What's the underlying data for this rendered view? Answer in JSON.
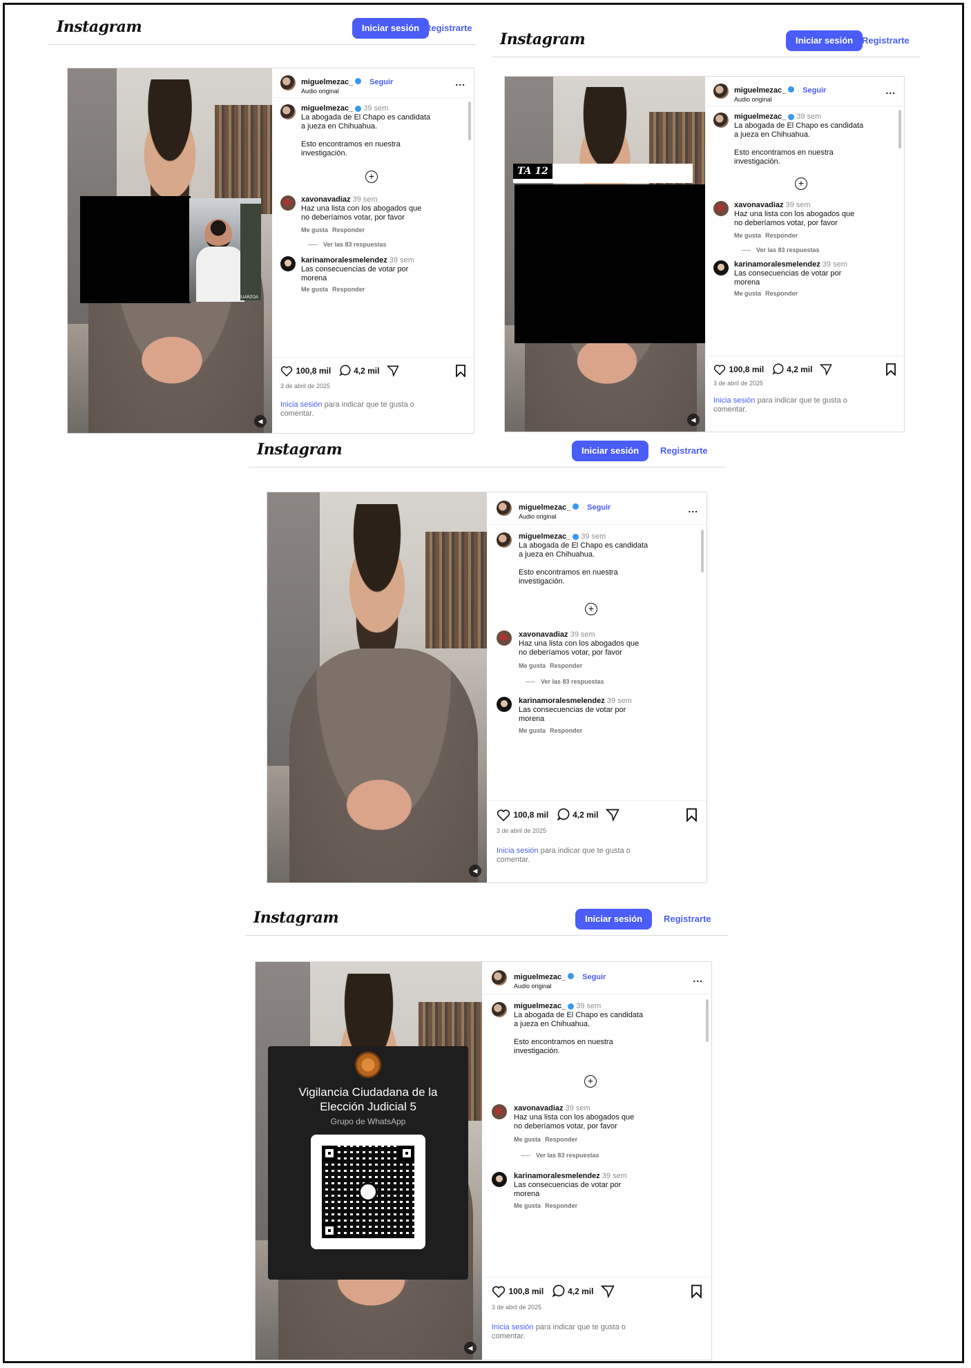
{
  "header": {
    "logo": "Instagram",
    "login_label": "Iniciar sesión",
    "register_label": "Registrarte"
  },
  "post": {
    "username": "miguelmezac_",
    "follow_label": "Seguir",
    "follow_sep": "·",
    "audio": "Audio original",
    "more": "...",
    "caption_time": "39 sem",
    "caption_line1": "La abogada de El Chapo es candidata",
    "caption_line2": "a jueza en Chihuahua.",
    "caption_line3": "Esto encontramos en nuestra",
    "caption_line4": "investigación.",
    "comment1_user": "xavonavadiaz",
    "comment1_time": "39 sem",
    "comment1_line1": "Haz una lista con los abogados que",
    "comment1_line2": "no deberíamos votar, por favor",
    "like_label": "Me gusta",
    "reply_label": "Responder",
    "view_replies": "Ver las 83 respuestas",
    "comment2_user": "karinamoralesmelendez",
    "comment2_time": "39 sem",
    "comment2_line1": "Las consecuencias de votar por",
    "comment2_line2": "morena",
    "likes": "100,8 mil",
    "comments": "4,2 mil",
    "date": "3 de abril de 2025",
    "signin_link": "Inicia sesión",
    "signin_rest": "para indicar que te gusta o",
    "signin_rest2": "comentar."
  },
  "overlay_banner": "TA 12",
  "overlay_watermark": "CUARZOA",
  "whatsapp_card": {
    "title_line1": "Vigilancia Ciudadana de la",
    "title_line2": "Elección Judicial 5",
    "subtitle": "Grupo de WhatsApp"
  },
  "colors": {
    "accent": "#4a5df9",
    "verified": "#3897f0"
  }
}
